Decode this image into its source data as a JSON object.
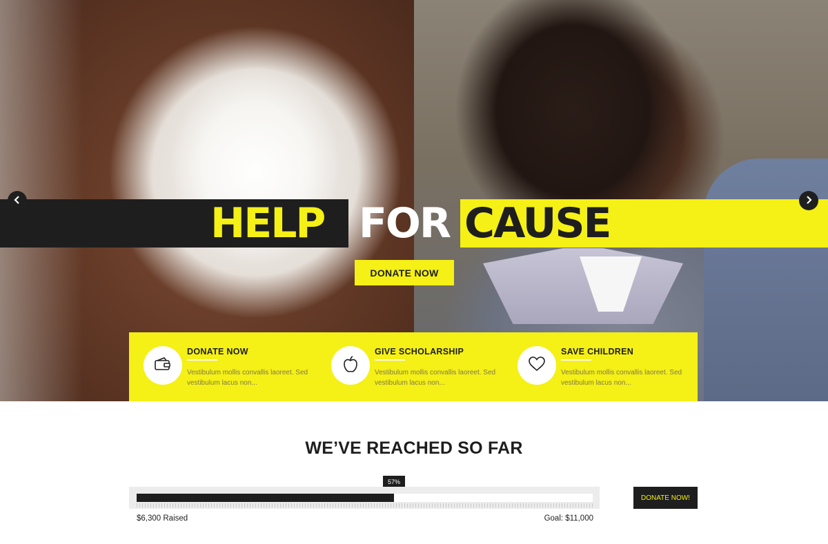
{
  "hero": {
    "headline": {
      "word1": "HELP",
      "word2": "FOR",
      "word3": "CAUSE"
    },
    "cta_label": "DONATE NOW",
    "prev_arrow": "‹",
    "next_arrow": "›"
  },
  "features": [
    {
      "title": "DONATE NOW",
      "desc": "Vestibulum mollis convallis laoreet. Sed vestibulum lacus non...",
      "icon": "wallet-icon"
    },
    {
      "title": "GIVE SCHOLARSHIP",
      "desc": "Vestibulum mollis convallis laoreet. Sed vestibulum lacus non...",
      "icon": "apple-icon"
    },
    {
      "title": "SAVE CHILDREN",
      "desc": "Vestibulum mollis convallis laoreet. Sed vestibulum lacus non...",
      "icon": "heart-icon"
    }
  ],
  "progress": {
    "title": "WE’VE REACHED SO FAR",
    "percent_label": "57%",
    "percent": 57,
    "raised_label": "$6,300 Raised",
    "goal_label": "Goal: $11,000",
    "button_label": "DONATE NOW!"
  },
  "colors": {
    "accent": "#f5f015",
    "dark": "#1e1e1e"
  }
}
